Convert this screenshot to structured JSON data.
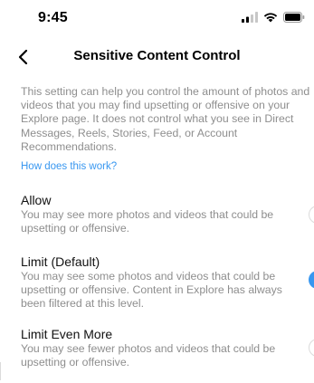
{
  "status_bar": {
    "time": "9:45"
  },
  "nav": {
    "title": "Sensitive Content Control"
  },
  "description": "This setting can help you control the amount of photos and videos that you may find upsetting or offensive on your Explore page. It does not control what you see in Direct Messages, Reels, Stories, Feed, or Account Recommendations.",
  "how_link": "How does this work?",
  "options": [
    {
      "label": "Allow",
      "description": "You may see more photos and videos that could be upsetting or offensive.",
      "selected": false
    },
    {
      "label": "Limit (Default)",
      "description": "You may see some photos and videos that could be upsetting or offensive. Content in Explore has always been filtered at this level.",
      "selected": true
    },
    {
      "label": "Limit Even More",
      "description": "You may see fewer photos and videos that could be upsetting or offensive.",
      "selected": false
    }
  ],
  "colors": {
    "accent": "#3897f0",
    "secondary_text": "#8e8e8e"
  }
}
